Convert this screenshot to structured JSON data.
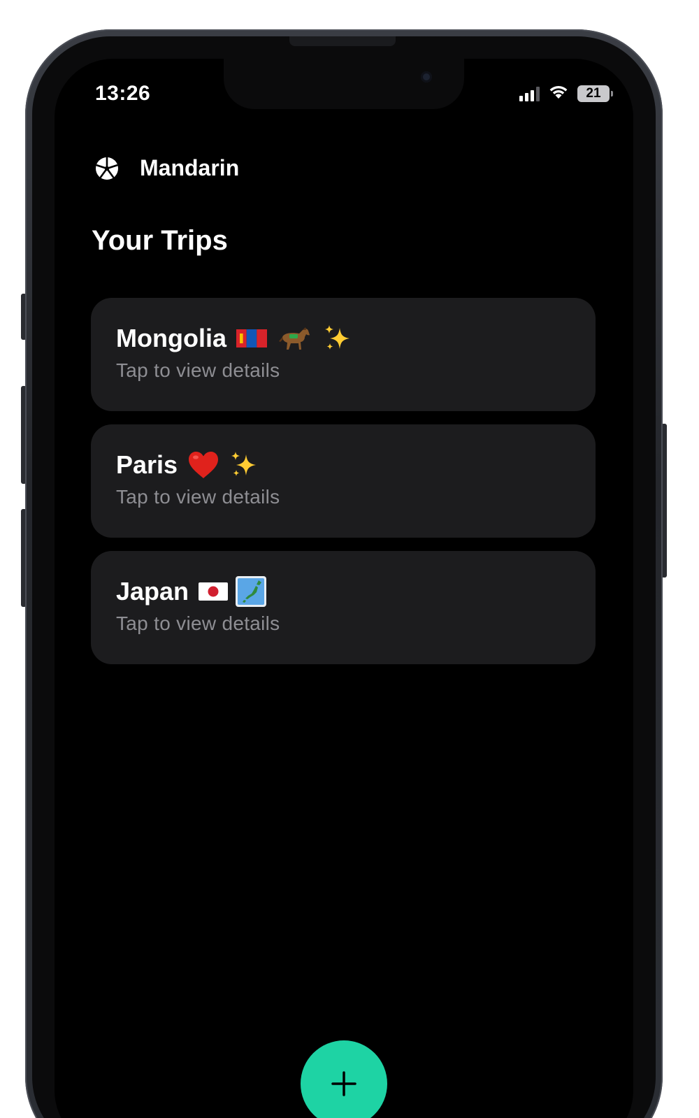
{
  "status_bar": {
    "time": "13:26",
    "battery_level": "21",
    "icons": [
      "signal-icon",
      "wifi-icon",
      "battery-icon"
    ]
  },
  "header": {
    "app_name": "Mandarin",
    "logo_icon": "mandarin-slice-icon"
  },
  "page": {
    "title": "Your Trips"
  },
  "trips": [
    {
      "name": "Mongolia",
      "subtitle": "Tap to view details",
      "emojis": [
        "mongolia-flag-icon",
        "horse-icon",
        "sparkles-icon"
      ]
    },
    {
      "name": "Paris",
      "subtitle": "Tap to view details",
      "emojis": [
        "red-heart-icon",
        "sparkles-icon"
      ]
    },
    {
      "name": "Japan",
      "subtitle": "Tap to view details",
      "emojis": [
        "japan-flag-icon",
        "japan-map-icon"
      ]
    }
  ],
  "fab": {
    "icon": "plus-icon",
    "color": "#1ed3a4"
  },
  "colors": {
    "background": "#000000",
    "card": "#1c1c1e",
    "subtitle": "#8e8e93",
    "accent": "#1ed3a4"
  }
}
